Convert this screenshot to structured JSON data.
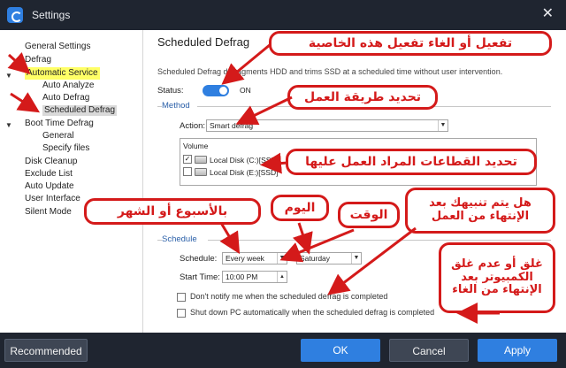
{
  "window": {
    "title": "Settings"
  },
  "sidebar": {
    "items": [
      {
        "label": "General Settings"
      },
      {
        "label": "Defrag"
      },
      {
        "label": "Automatic Service"
      },
      {
        "label": "Auto Analyze"
      },
      {
        "label": "Auto Defrag"
      },
      {
        "label": "Scheduled Defrag"
      },
      {
        "label": "Boot Time Defrag"
      },
      {
        "label": "General"
      },
      {
        "label": "Specify files"
      },
      {
        "label": "Disk Cleanup"
      },
      {
        "label": "Exclude List"
      },
      {
        "label": "Auto Update"
      },
      {
        "label": "User Interface"
      },
      {
        "label": "Silent Mode"
      }
    ]
  },
  "main": {
    "title": "Scheduled Defrag",
    "description": "Scheduled Defrag defragments HDD and trims SSD at a scheduled time without user intervention.",
    "status_label": "Status:",
    "status_value": "ON",
    "method_group": "Method",
    "action_label": "Action:",
    "action_value": "Smart defrag",
    "volume_header": "Volume",
    "volumes": [
      {
        "label": "Local Disk (C:)[SSD]",
        "checked": true
      },
      {
        "label": "Local Disk (E:)[SSD]",
        "checked": false
      }
    ],
    "schedule_group": "Schedule",
    "schedule_label": "Schedule:",
    "schedule_value": "Every week",
    "day_value": "Saturday",
    "start_time_label": "Start Time:",
    "start_time_value": "10:00 PM",
    "notify_label": "Don't notify me when the scheduled defrag is completed",
    "notify_checked": false,
    "shutdown_label": "Shut down PC automatically when the scheduled defrag is completed",
    "shutdown_checked": false
  },
  "footer": {
    "recommended": "Recommended",
    "ok": "OK",
    "cancel": "Cancel",
    "apply": "Apply"
  },
  "annotations": {
    "toggle_feature": "تفعيل أو الغاء تفعيل هذه الخاصية",
    "work_method": "تحديد طريقة العمل",
    "target_sectors": "تحديد القطاعات المراد العمل عليها",
    "notify_question_1": "هل يتم تنبيهك بعد",
    "notify_question_2": "الإنتهاء من العمل",
    "weekly_monthly": "بالأسبوع أو الشهر",
    "day": "اليوم",
    "time": "الوقت",
    "shutdown_1": "غلق أو عدم غلق",
    "shutdown_2": "الكمبيوتر بعد",
    "shutdown_3": "الإنتهاء من الغاء"
  },
  "colors": {
    "accent": "#2f7fe0",
    "annotation": "#d41a1a",
    "highlight": "#ffff66",
    "dark_bg": "#1f2530"
  }
}
